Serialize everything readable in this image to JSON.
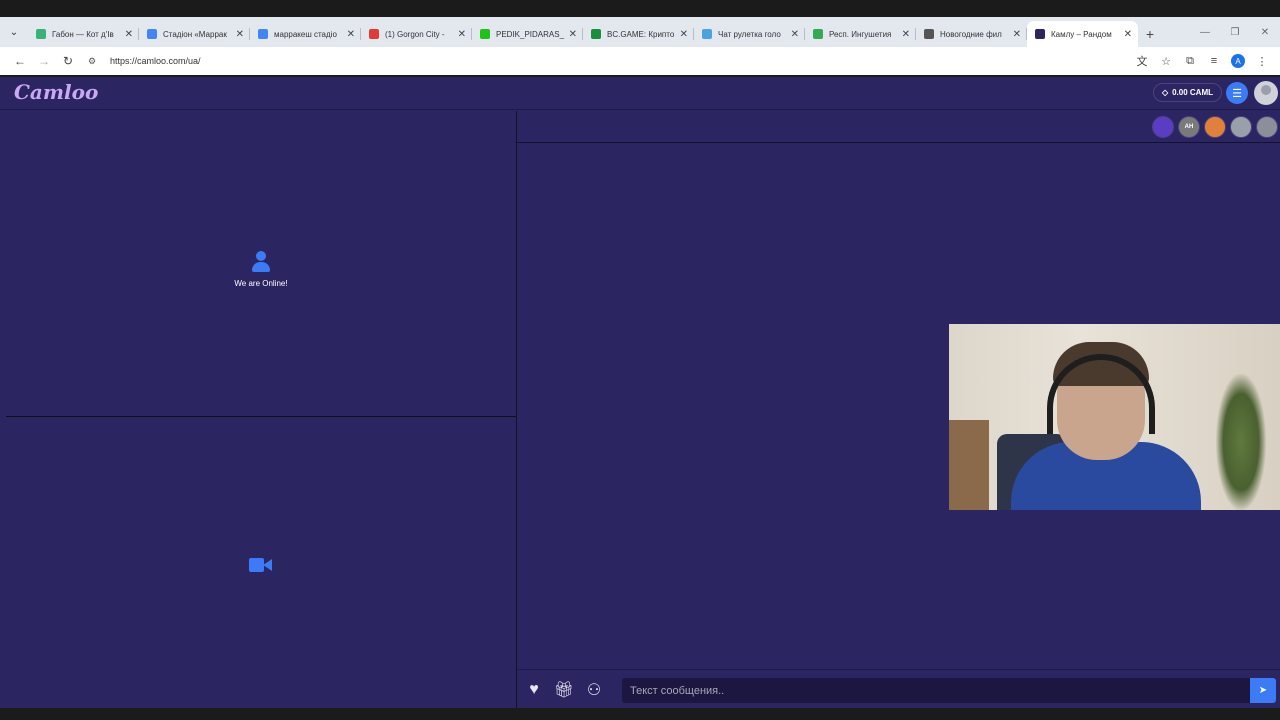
{
  "browser": {
    "tabs": [
      {
        "title": "Габон — Кот д'Ів",
        "favicon": "green-page-icon",
        "color": "#3ab07a"
      },
      {
        "title": "Стадіон «Маррак",
        "favicon": "google-icon",
        "color": "#4285f4"
      },
      {
        "title": "марракеш стадіо",
        "favicon": "google-icon",
        "color": "#4285f4"
      },
      {
        "title": "(1) Gorgon City -",
        "favicon": "youtube-icon",
        "color": "#e53935"
      },
      {
        "title": "PEDIK_PIDARAS_",
        "favicon": "kick-icon",
        "color": "#1fc216"
      },
      {
        "title": "BC.GAME: Крипто",
        "favicon": "bcgame-icon",
        "color": "#1a8f3a"
      },
      {
        "title": "Чат рулетка голо",
        "favicon": "chat-icon",
        "color": "#4aa3df"
      },
      {
        "title": "Респ. Ингушетия",
        "favicon": "maps-pin-icon",
        "color": "#34a853"
      },
      {
        "title": "Новогодние фил",
        "favicon": "globe-icon",
        "color": "#555555"
      },
      {
        "title": "Камлу – Рандом",
        "favicon": "camloo-icon",
        "color": "#2b2561"
      }
    ],
    "active_tab_index": 9,
    "url": "https://camloo.com/ua/"
  },
  "site": {
    "logo": "Camloo",
    "balance": "0.00 CAML",
    "online_text": "We are Online!",
    "chat_placeholder": "Текст сообщения..",
    "header_avatars": [
      {
        "name": "avatar-1",
        "label": "",
        "color": "#5b3cc4"
      },
      {
        "name": "avatar-2",
        "label": "AH",
        "color": "#7a7a7a"
      },
      {
        "name": "avatar-3",
        "label": "",
        "color": "#e0803a"
      },
      {
        "name": "avatar-4",
        "label": "",
        "color": "#9aa0aa"
      },
      {
        "name": "avatar-5",
        "label": "",
        "color": "#8a8f99"
      }
    ]
  },
  "colors": {
    "site_bg": "#2b2561",
    "accent": "#3b7bf5"
  }
}
